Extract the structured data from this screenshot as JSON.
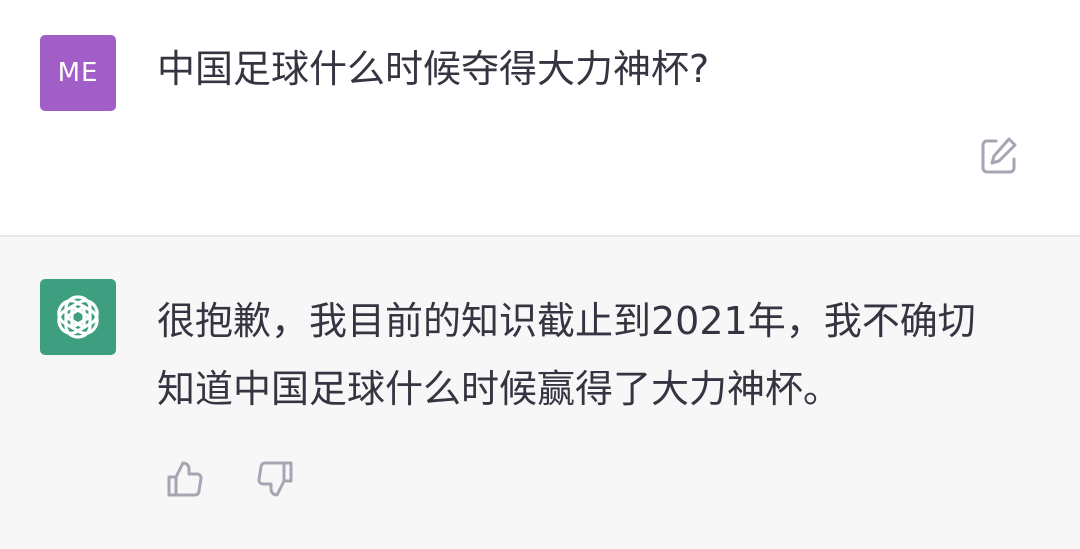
{
  "user_message": {
    "avatar_text": "ME",
    "text": "中国足球什么时候夺得大力神杯?",
    "avatar_color": "#a25ec7",
    "icons": [
      "edit-icon"
    ]
  },
  "assistant_message": {
    "lines": [
      "很抱歉，我目前的知识截止到2021年，我不确切",
      "知道中国足球什么时候赢得了大力神杯。"
    ],
    "avatar_color": "#3d9f80",
    "avatar_icon": "openai-logo-icon",
    "icons": [
      "thumbs-up-icon",
      "thumbs-down-icon"
    ]
  },
  "colors": {
    "text": "#343541",
    "assistant_background": "#f7f7f8",
    "icon_gray": "#a6a6b3"
  }
}
